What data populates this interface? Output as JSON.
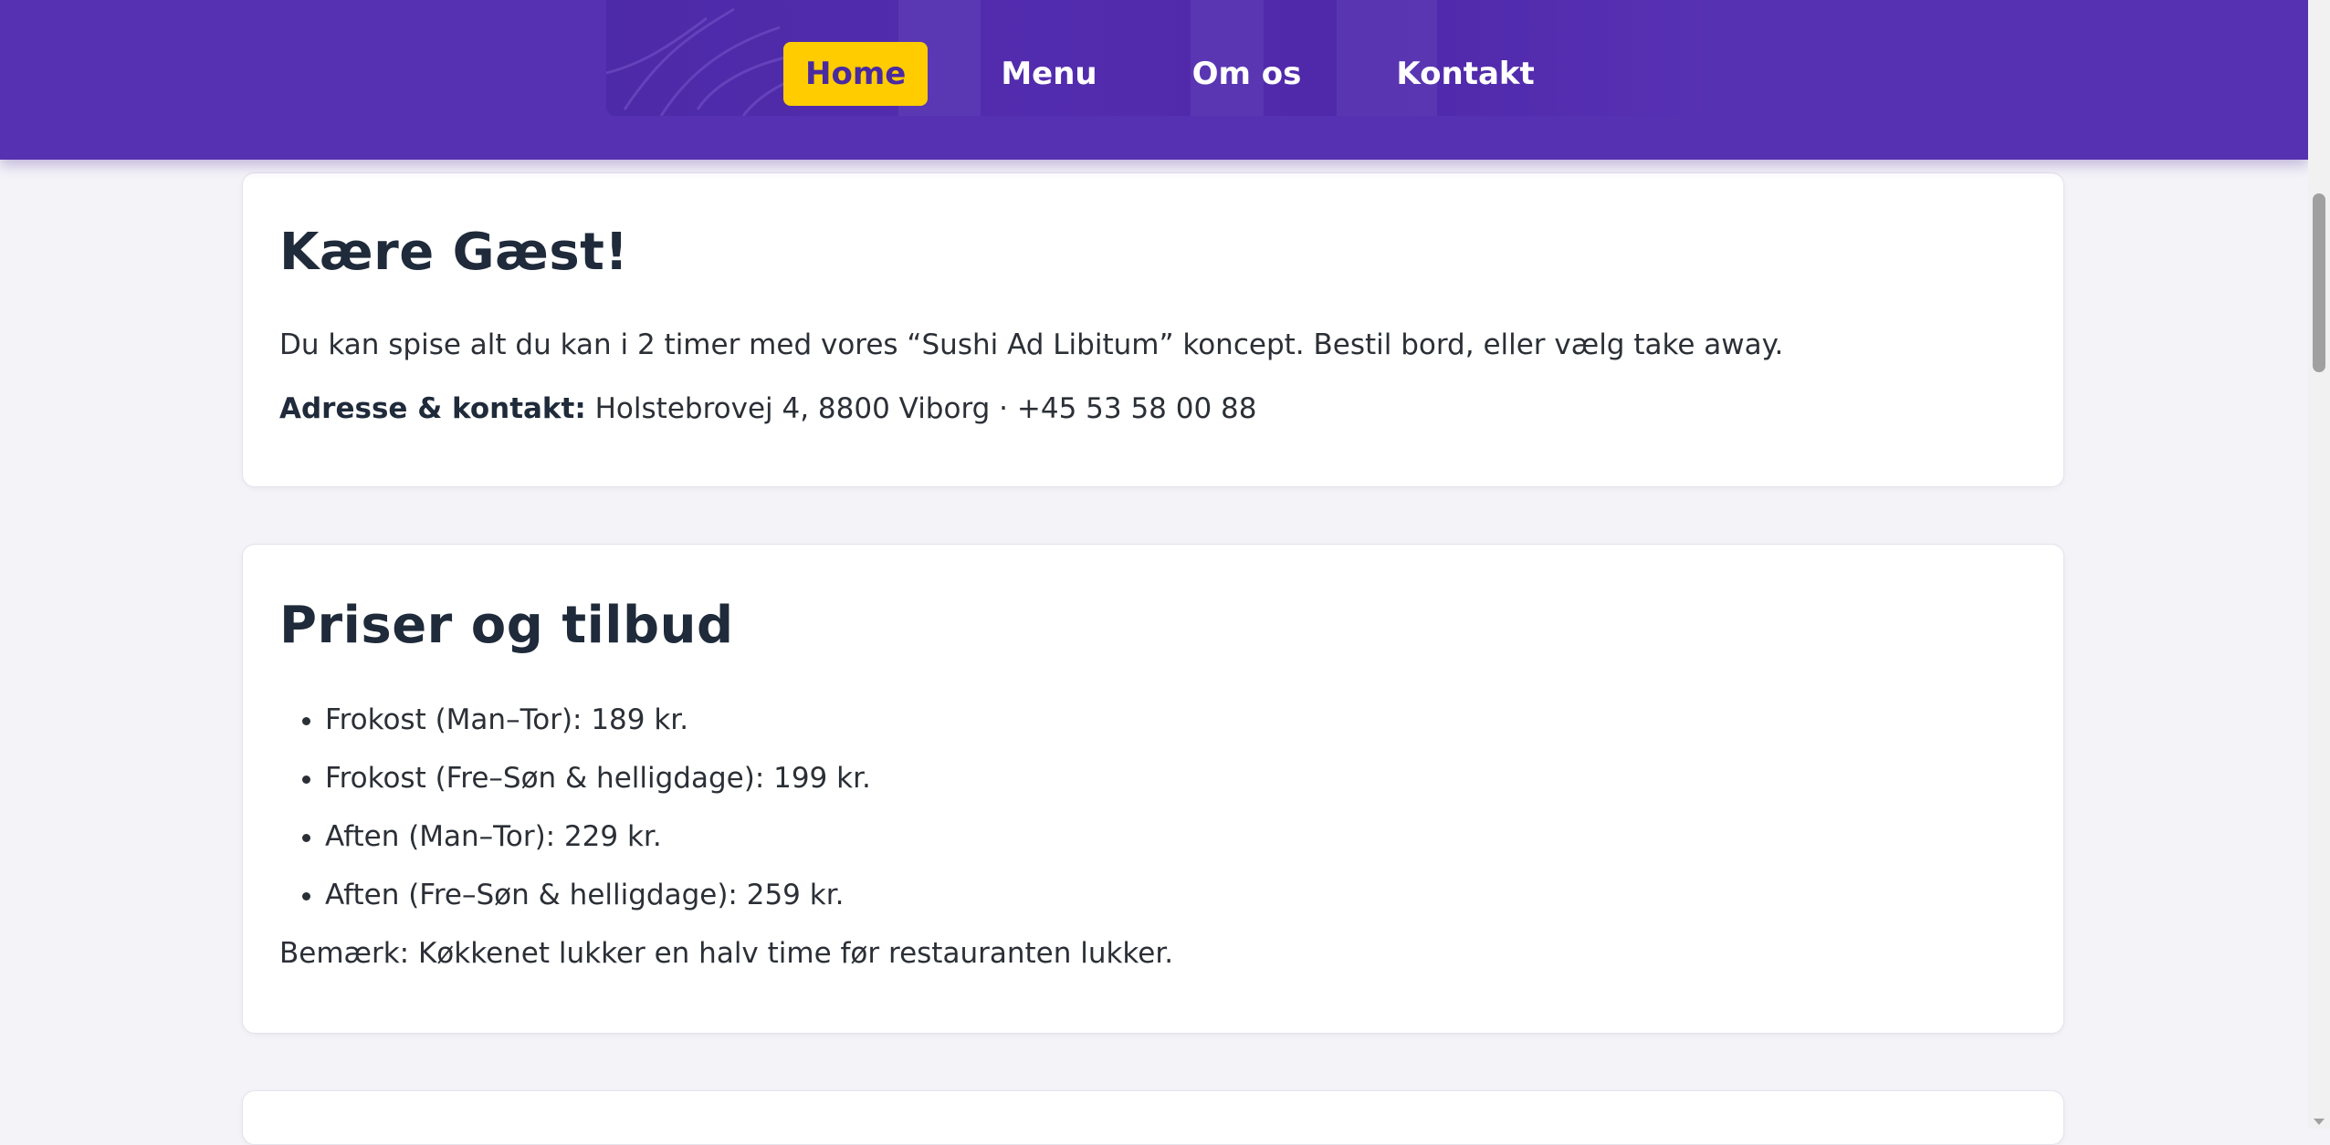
{
  "nav": {
    "items": [
      {
        "label": "Home",
        "active": true
      },
      {
        "label": "Menu",
        "active": false
      },
      {
        "label": "Om os",
        "active": false
      },
      {
        "label": "Kontakt",
        "active": false
      }
    ]
  },
  "colors": {
    "header_bg": "#5631b2",
    "active_nav_bg": "#ffcc00",
    "page_bg": "#f4f3f8",
    "heading": "#1f2a3a"
  },
  "welcome": {
    "title": "Kære Gæst!",
    "intro": "Du kan spise alt du kan i 2 timer med vores “Sushi Ad Libitum” koncept. Bestil bord, eller vælg take away.",
    "contact_label": "Adresse & kontakt:",
    "contact_value": "Holstebrovej 4, 8800 Viborg · +45 53 58 00 88"
  },
  "prices": {
    "title": "Priser og tilbud",
    "items": [
      "Frokost (Man–Tor): 189 kr.",
      "Frokost (Fre–Søn & helligdage): 199 kr.",
      "Aften (Man–Tor): 229 kr.",
      "Aften (Fre–Søn & helligdage): 259 kr."
    ],
    "note": "Bemærk: Køkkenet lukker en halv time før restauranten lukker."
  }
}
